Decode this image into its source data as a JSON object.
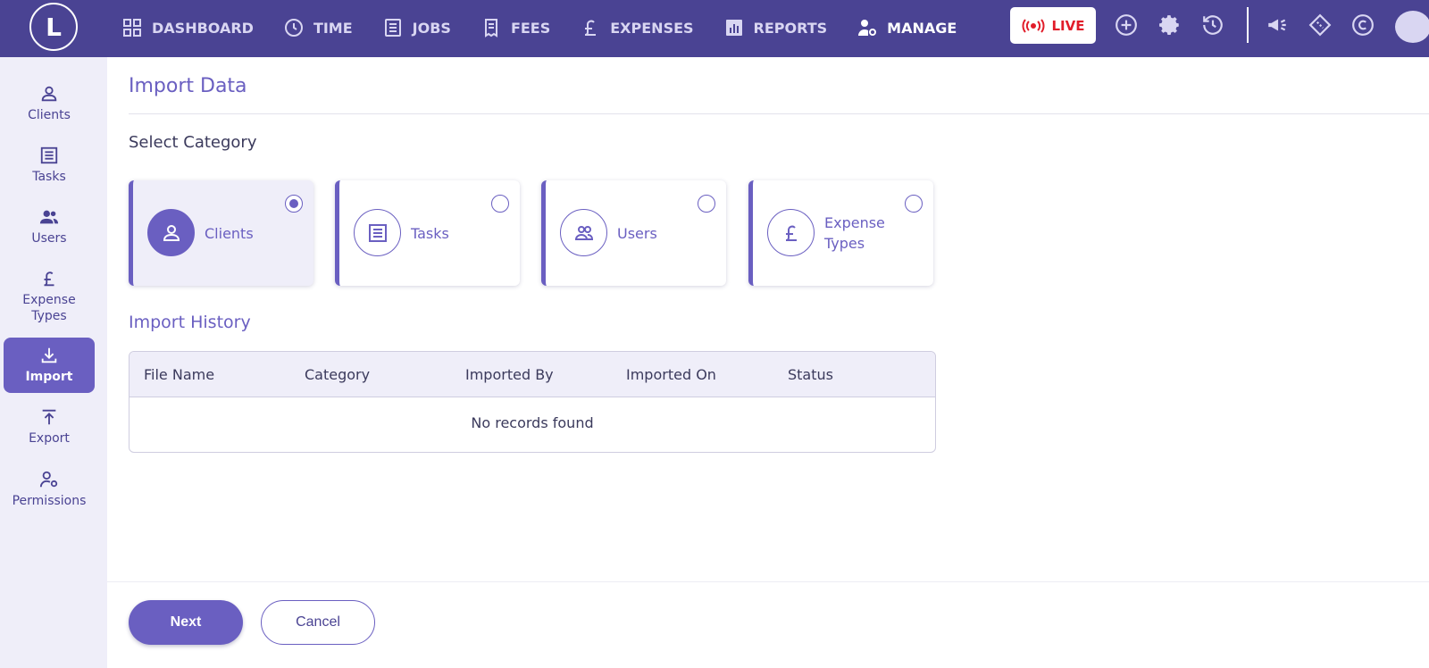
{
  "app": {
    "logo_letter": "L"
  },
  "nav": [
    {
      "label": "DASHBOARD",
      "icon": "dashboard-grid-icon"
    },
    {
      "label": "TIME",
      "icon": "clock-icon"
    },
    {
      "label": "JOBS",
      "icon": "list-icon"
    },
    {
      "label": "FEES",
      "icon": "receipt-icon"
    },
    {
      "label": "EXPENSES",
      "icon": "pound-icon"
    },
    {
      "label": "REPORTS",
      "icon": "bar-chart-icon"
    },
    {
      "label": "MANAGE",
      "icon": "user-gear-icon",
      "active": true
    }
  ],
  "toolbar": {
    "live_label": "LIVE"
  },
  "sidebar": [
    {
      "label": "Clients",
      "icon": "person-icon"
    },
    {
      "label": "Tasks",
      "icon": "list-icon"
    },
    {
      "label": "Users",
      "icon": "users-icon"
    },
    {
      "label": "Expense Types",
      "icon": "pound-icon"
    },
    {
      "label": "Import",
      "icon": "download-icon",
      "active": true
    },
    {
      "label": "Export",
      "icon": "upload-icon"
    },
    {
      "label": "Permissions",
      "icon": "user-gear-icon"
    }
  ],
  "page": {
    "title": "Import Data",
    "select_category_label": "Select Category",
    "categories": [
      {
        "label": "Clients",
        "icon": "person-icon",
        "selected": true
      },
      {
        "label": "Tasks",
        "icon": "list-icon",
        "selected": false
      },
      {
        "label": "Users",
        "icon": "users-icon",
        "selected": false
      },
      {
        "label": "Expense Types",
        "icon": "pound-icon",
        "selected": false
      }
    ],
    "history_label": "Import History",
    "table": {
      "columns": [
        "File Name",
        "Category",
        "Imported By",
        "Imported On",
        "Status"
      ],
      "empty_text": "No records found"
    }
  },
  "footer": {
    "next_label": "Next",
    "cancel_label": "Cancel"
  },
  "colors": {
    "brand": "#4a4393",
    "accent": "#6a5fc1",
    "live": "#e11d2a",
    "sidebar_bg": "#efeef9"
  }
}
